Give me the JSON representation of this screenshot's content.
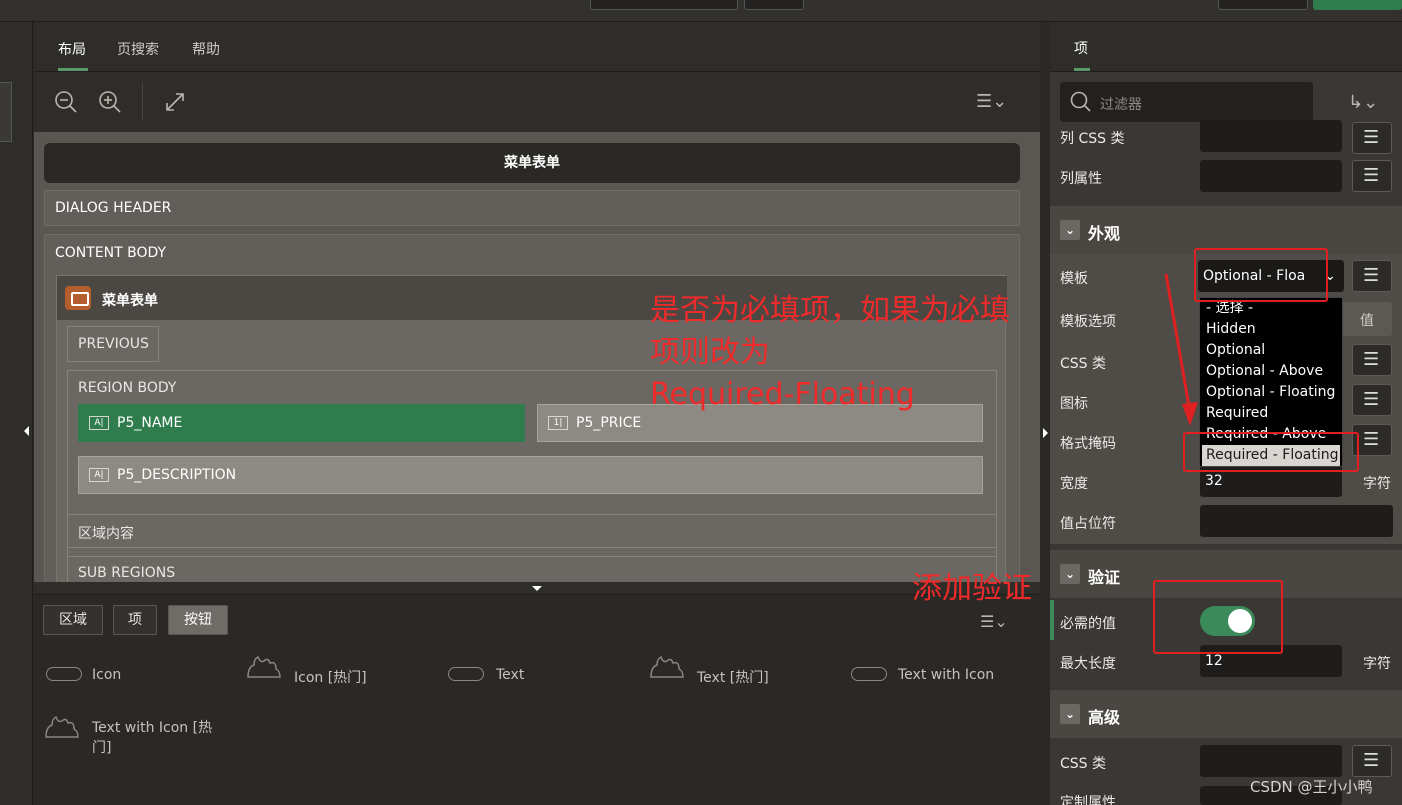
{
  "center": {
    "tabs": [
      "布局",
      "页搜索",
      "帮助"
    ],
    "page_title": "菜单表单",
    "dialog_header": "DIALOG HEADER",
    "content_body": "CONTENT BODY",
    "region_title": "菜单表单",
    "previous": "PREVIOUS",
    "region_body": "REGION BODY",
    "items": [
      {
        "name": "P5_NAME",
        "tag": "A|"
      },
      {
        "name": "P5_PRICE",
        "tag": "1|"
      },
      {
        "name": "P5_DESCRIPTION",
        "tag": "A|"
      }
    ],
    "region_content": "区域内容",
    "sub_regions": "SUB REGIONS"
  },
  "gallery": {
    "tabs": [
      "区域",
      "项",
      "按钮"
    ],
    "items": [
      "Icon",
      "Icon [热门]",
      "Text",
      "Text [热门]",
      "Text with Icon",
      "Text with Icon [热",
      "门]"
    ]
  },
  "right": {
    "tab": "项",
    "filter_placeholder": "过滤器",
    "col_css": "列 CSS 类",
    "col_attr": "列属性",
    "appearance": "外观",
    "template": "模板",
    "template_value": "Optional - Floa",
    "template_options": "模板选项",
    "template_options_hint": "值",
    "css_class": "CSS 类",
    "icon": "图标",
    "format_mask": "格式掩码",
    "width": "宽度",
    "width_value": "32",
    "width_unit": "字符",
    "placeholder": "值占位符",
    "validation": "验证",
    "required": "必需的值",
    "max_length": "最大长度",
    "max_length_value": "12",
    "max_length_unit": "字符",
    "advanced": "高级",
    "css_class2": "CSS 类",
    "custom_attr": "定制属性",
    "dropdown_options": [
      "- 选择 -",
      "Hidden",
      "Optional",
      "Optional - Above",
      "Optional - Floating",
      "Required",
      "Required - Above",
      "Required - Floating"
    ]
  },
  "annotations": {
    "note1_line1": "是否为必填项，如果为必填",
    "note1_line2": "项则改为",
    "note1_line3": "Required-Floating",
    "note2": "添加验证"
  },
  "watermark": "CSDN @王小小鸭",
  "colors": {
    "accent_green": "#3a8a5a",
    "annotation_red": "#e02020"
  }
}
